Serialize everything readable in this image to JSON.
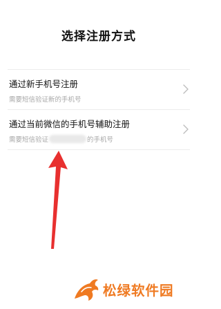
{
  "page": {
    "title": "选择注册方式"
  },
  "options": [
    {
      "title": "通过新手机号注册",
      "subtitle": "需要短信验证新的手机号"
    },
    {
      "title": "通过当前微信的手机号辅助注册",
      "subtitle_prefix": "需要短信验证",
      "subtitle_suffix": "的手机号"
    }
  ],
  "icons": {
    "chevron": "chevron-right-icon",
    "annotation": "red-arrow-up"
  },
  "watermark": {
    "text": "松绿软件园"
  },
  "colors": {
    "accent_arrow": "#e8302f",
    "watermark": "#ef7a22",
    "divider": "#ececec",
    "subtitle": "#a8a8a8"
  }
}
